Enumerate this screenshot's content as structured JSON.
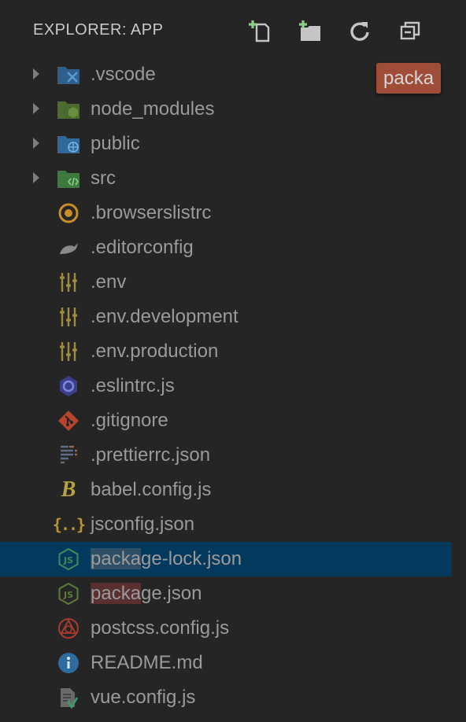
{
  "explorer": {
    "title": "EXPLORER: APP",
    "actions": [
      {
        "name": "new-file-icon"
      },
      {
        "name": "new-folder-icon"
      },
      {
        "name": "refresh-icon"
      },
      {
        "name": "collapse-all-icon"
      }
    ]
  },
  "tooltip": {
    "text": "packa"
  },
  "files": [
    {
      "label": ".vscode",
      "icon": "vscode-folder-icon",
      "folder": true
    },
    {
      "label": "node_modules",
      "icon": "node-folder-icon",
      "folder": true
    },
    {
      "label": "public",
      "icon": "public-folder-icon",
      "folder": true
    },
    {
      "label": "src",
      "icon": "src-folder-icon",
      "folder": true
    },
    {
      "label": ".browserslistrc",
      "icon": "browserslist-icon"
    },
    {
      "label": ".editorconfig",
      "icon": "editorconfig-icon"
    },
    {
      "label": ".env",
      "icon": "env-icon"
    },
    {
      "label": ".env.development",
      "icon": "env-icon"
    },
    {
      "label": ".env.production",
      "icon": "env-icon"
    },
    {
      "label": ".eslintrc.js",
      "icon": "eslint-icon"
    },
    {
      "label": ".gitignore",
      "icon": "git-icon"
    },
    {
      "label": ".prettierrc.json",
      "icon": "prettier-icon"
    },
    {
      "label": "babel.config.js",
      "icon": "babel-icon"
    },
    {
      "label": "jsconfig.json",
      "icon": "json-icon"
    },
    {
      "label_pre": "packa",
      "label_post": "ge-lock.json",
      "label": "package-lock.json",
      "icon": "nodejs-icon",
      "selected": true
    },
    {
      "label_pre": "packa",
      "label_post": "ge.json",
      "label": "package.json",
      "icon": "nodejs-icon"
    },
    {
      "label": "postcss.config.js",
      "icon": "postcss-icon"
    },
    {
      "label": "README.md",
      "icon": "info-icon"
    },
    {
      "label": "vue.config.js",
      "icon": "vue-config-icon"
    }
  ],
  "colors": {
    "background": "#252526",
    "selected_row": "#04395e",
    "tooltip": "#b3533c"
  }
}
